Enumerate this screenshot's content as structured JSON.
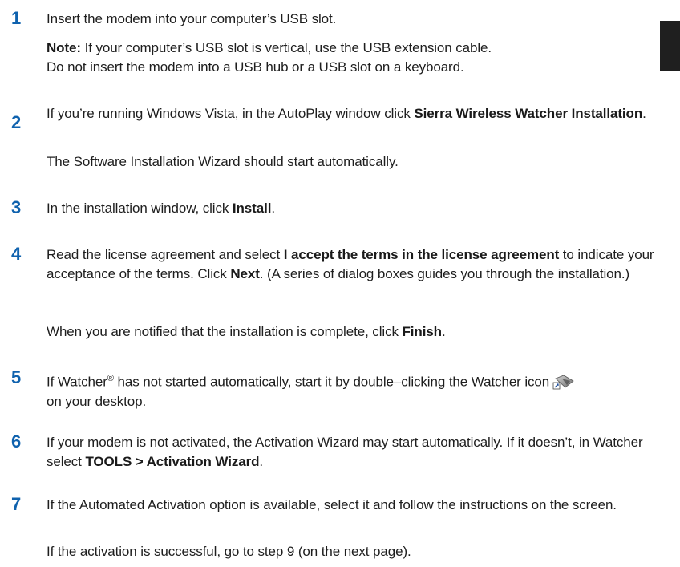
{
  "steps": [
    {
      "number": "1",
      "text": "Insert the modem into your computer’s USB slot.",
      "note_label": "Note:",
      "note_line1": " If your computer’s USB slot is vertical, use the USB extension cable.",
      "note_line2": "Do not insert the modem into a USB hub or a USB slot on a keyboard."
    },
    {
      "number": "2",
      "text_before": "If you’re running Windows Vista, in the AutoPlay window click ",
      "bold": "Sierra Wireless Watcher Installation",
      "text_after": ".",
      "followup": "The Software Installation Wizard should start automatically."
    },
    {
      "number": "3",
      "text_before": "In the installation window, click ",
      "bold": "Install",
      "text_after": "."
    },
    {
      "number": "4",
      "text_before": "Read the license agreement and select ",
      "bold1": "I accept the terms in the license agreement",
      "text_mid": " to indicate your acceptance of the terms. Click ",
      "bold2": "Next",
      "text_after": ". (A series of dialog boxes guides you through the installation.)",
      "followup_before": "When you are notified that the installation is complete, click ",
      "followup_bold": "Finish",
      "followup_after": "."
    },
    {
      "number": "5",
      "text_before": "If Watcher",
      "sup": "®",
      "text_after": " has not started automatically, start it by double–clicking the Watcher icon",
      "icon": "watcher-shortcut-icon",
      "text_end": "on your desktop."
    },
    {
      "number": "6",
      "text_before": "If your modem is not activated, the Activation Wizard may start automatically. If it doesn’t, in Watcher select ",
      "bold": "TOOLS > Activation Wizard",
      "text_after": "."
    },
    {
      "number": "7",
      "text": "If the Automated Activation option is available, select it and follow the instructions on the screen.",
      "followup": "If the activation is successful, go to step 9 (on the next page)."
    }
  ]
}
